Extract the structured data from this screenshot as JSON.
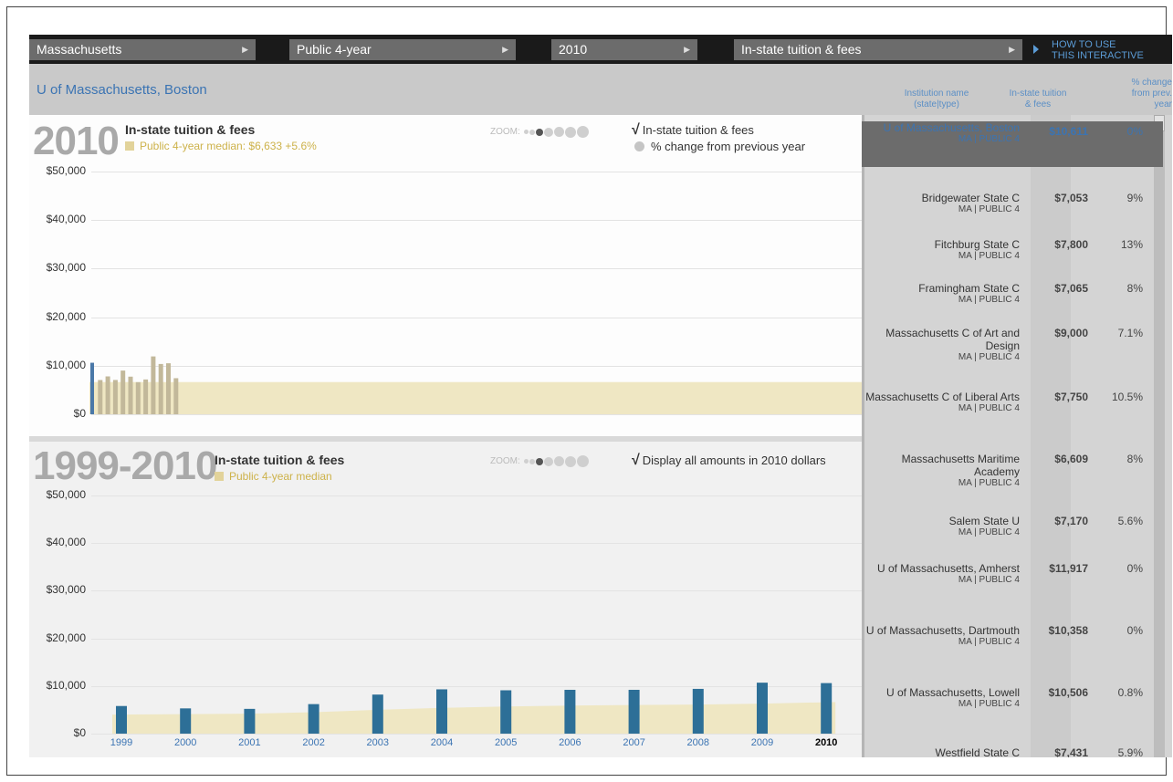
{
  "selectors": [
    {
      "label": "Massachusetts"
    },
    {
      "label": "Public 4-year"
    },
    {
      "label": "2010"
    },
    {
      "label": "In-state tuition & fees"
    }
  ],
  "howto": {
    "line1": "HOW TO USE",
    "line2": "THIS INTERACTIVE"
  },
  "selected_institution": "U of Massachusetts, Boston",
  "columns": {
    "name_l1": "Institution name",
    "name_l2": "(state|type)",
    "tuition_l1": "In-state tuition",
    "tuition_l2": "& fees",
    "change_l1": "% change",
    "change_l2": "from prev.",
    "change_l3": "year"
  },
  "panel1": {
    "year": "2010",
    "title": "In-state tuition & fees",
    "subtitle": "Public 4-year median: $6,633 +5.6%",
    "zoom_label": "ZOOM:",
    "opt1": "In-state tuition & fees",
    "opt2": "% change from previous year",
    "y_ticks": [
      "$50,000",
      "$40,000",
      "$30,000",
      "$20,000",
      "$10,000",
      "$0"
    ]
  },
  "panel2": {
    "year": "1999-2010",
    "title": "In-state tuition & fees",
    "subtitle": "Public 4-year median",
    "zoom_label": "ZOOM:",
    "opt1": "Display all amounts in 2010 dollars",
    "y_ticks": [
      "$50,000",
      "$40,000",
      "$30,000",
      "$20,000",
      "$10,000",
      "$0"
    ]
  },
  "colors": {
    "accent": "#3b74b3",
    "bar_current": "#4a78a8",
    "bar_other": "#c2b89a",
    "median_band": "#efe7c3",
    "history_bar": "#2d6f97"
  },
  "chart_data": [
    {
      "type": "bar",
      "title": "In-state tuition & fees",
      "subtitle": "Public 4-year median: $6,633 +5.6%",
      "ylim": [
        0,
        50000
      ],
      "median": 6633,
      "highlighted": "U of Massachusetts, Boston",
      "values": [
        10611,
        7053,
        7800,
        7065,
        9000,
        7750,
        6609,
        7170,
        11917,
        10358,
        10506,
        7431
      ]
    },
    {
      "type": "bar",
      "title": "In-state tuition & fees",
      "subtitle": "Public 4-year median",
      "ylim": [
        0,
        50000
      ],
      "categories": [
        "1999",
        "2000",
        "2001",
        "2002",
        "2003",
        "2004",
        "2005",
        "2006",
        "2007",
        "2008",
        "2009",
        "2010"
      ],
      "series": [
        {
          "name": "U of Massachusetts, Boston",
          "values": [
            5800,
            5300,
            5200,
            6200,
            8200,
            9300,
            9100,
            9200,
            9200,
            9400,
            10700,
            10611
          ]
        },
        {
          "name": "Public 4-year median",
          "values": [
            4000,
            4100,
            4200,
            4500,
            5000,
            5400,
            5700,
            5900,
            6000,
            6100,
            6300,
            6633
          ]
        }
      ]
    }
  ],
  "institutions": [
    {
      "name": "U of Massachusetts, Boston",
      "sub": "MA | PUBLIC 4",
      "tuition": "$10,611",
      "change": "0%",
      "selected": true
    },
    {
      "name": "Bridgewater State C",
      "sub": "MA | PUBLIC 4",
      "tuition": "$7,053",
      "change": "9%"
    },
    {
      "name": "Fitchburg State C",
      "sub": "MA | PUBLIC 4",
      "tuition": "$7,800",
      "change": "13%"
    },
    {
      "name": "Framingham State C",
      "sub": "MA | PUBLIC 4",
      "tuition": "$7,065",
      "change": "8%"
    },
    {
      "name": "Massachusetts C of Art and Design",
      "sub": "MA | PUBLIC 4",
      "tuition": "$9,000",
      "change": "7.1%"
    },
    {
      "name": "Massachusetts C of Liberal Arts",
      "sub": "MA | PUBLIC 4",
      "tuition": "$7,750",
      "change": "10.5%"
    },
    {
      "name": "Massachusetts Maritime Academy",
      "sub": "MA | PUBLIC 4",
      "tuition": "$6,609",
      "change": "8%"
    },
    {
      "name": "Salem State U",
      "sub": "MA | PUBLIC 4",
      "tuition": "$7,170",
      "change": "5.6%"
    },
    {
      "name": "U of Massachusetts, Amherst",
      "sub": "MA | PUBLIC 4",
      "tuition": "$11,917",
      "change": "0%"
    },
    {
      "name": "U of Massachusetts, Dartmouth",
      "sub": "MA | PUBLIC 4",
      "tuition": "$10,358",
      "change": "0%"
    },
    {
      "name": "U of Massachusetts, Lowell",
      "sub": "MA | PUBLIC 4",
      "tuition": "$10,506",
      "change": "0.8%"
    },
    {
      "name": "Westfield State C",
      "sub": "",
      "tuition": "$7,431",
      "change": "5.9%"
    }
  ]
}
